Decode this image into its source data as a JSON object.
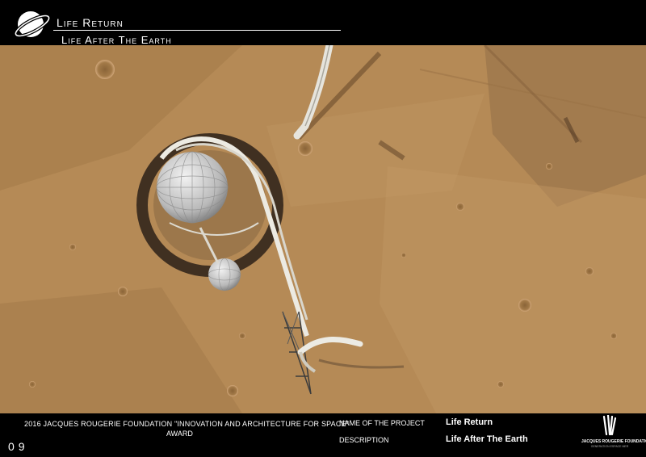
{
  "header": {
    "title": "Life Return",
    "subtitle": "Life After The Earth"
  },
  "footer": {
    "award_line_1": "2016 JACQUES ROUGERIE FOUNDATION \"INNOVATION AND ARCHITECTURE FOR SPACE\"",
    "award_line_2": "AWARD",
    "page_number": "09",
    "name_label": "NAME OF THE PROJECT",
    "description_label": "DESCRIPTION",
    "project_name": "Life Return",
    "project_description": "Life After The Earth",
    "foundation_name": "JACQUES ROUGERIE FOUNDATION",
    "foundation_subtitle": "GENERATION ESPACE MER"
  },
  "icons": {
    "header_logo": "planet-icon",
    "foundation_logo": "foundation-logo"
  },
  "colors": {
    "background": "#000000",
    "terrain": "#b58a56",
    "text": "#ffffff"
  }
}
